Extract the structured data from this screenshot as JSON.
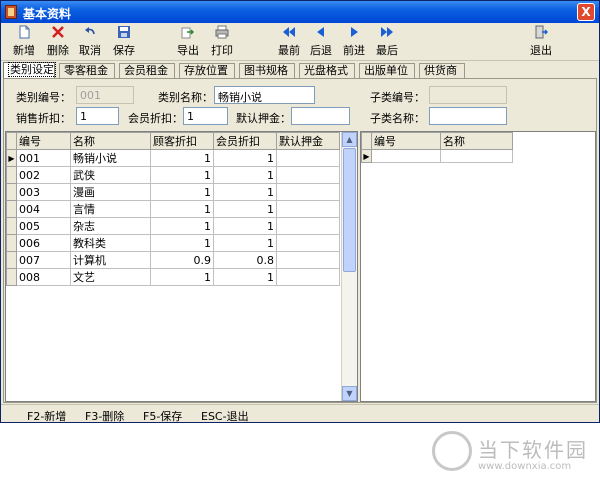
{
  "window": {
    "title": "基本资料",
    "close": "X"
  },
  "toolbar": {
    "new": "新增",
    "delete": "删除",
    "cancel": "取消",
    "save": "保存",
    "export": "导出",
    "print": "打印",
    "first": "最前",
    "prev": "后退",
    "next": "前进",
    "last": "最后",
    "exit": "退出"
  },
  "tabs": [
    "类别设定",
    "零客租金",
    "会员租金",
    "存放位置",
    "图书规格",
    "光盘格式",
    "出版单位",
    "供货商"
  ],
  "form": {
    "category_code_label": "类别编号：",
    "category_code_value": "001",
    "category_name_label": "类别名称：",
    "category_name_value": "畅销小说",
    "sale_discount_label": "销售折扣：",
    "sale_discount_value": "1",
    "member_discount_label": "会员折扣：",
    "member_discount_value": "1",
    "default_deposit_label": "默认押金：",
    "default_deposit_value": "",
    "sub_code_label": "子类编号：",
    "sub_code_value": "",
    "sub_name_label": "子类名称：",
    "sub_name_value": ""
  },
  "main_grid": {
    "columns": [
      "编号",
      "名称",
      "顾客折扣",
      "会员折扣",
      "默认押金"
    ],
    "rows": [
      [
        "001",
        "畅销小说",
        "1",
        "1",
        ""
      ],
      [
        "002",
        "武侠",
        "1",
        "1",
        ""
      ],
      [
        "003",
        "漫画",
        "1",
        "1",
        ""
      ],
      [
        "004",
        "言情",
        "1",
        "1",
        ""
      ],
      [
        "005",
        "杂志",
        "1",
        "1",
        ""
      ],
      [
        "006",
        "教科类",
        "1",
        "1",
        ""
      ],
      [
        "007",
        "计算机",
        "0.9",
        "0.8",
        ""
      ],
      [
        "008",
        "文艺",
        "1",
        "1",
        ""
      ]
    ],
    "current_row_marker": "▶"
  },
  "sub_grid": {
    "columns": [
      "编号",
      "名称"
    ],
    "current_row_marker": "▶"
  },
  "statusbar": {
    "f2": "F2-新增",
    "f3": "F3-删除",
    "f5": "F5-保存",
    "esc": "ESC-退出"
  },
  "watermark": {
    "brand": "当下软件园",
    "url": "www.downxia.com"
  },
  "colors": {
    "titlebar": "#0b5fe0",
    "face": "#ece9d8",
    "nav_arrow": "#1b5fd6",
    "delete_x": "#d22020"
  }
}
